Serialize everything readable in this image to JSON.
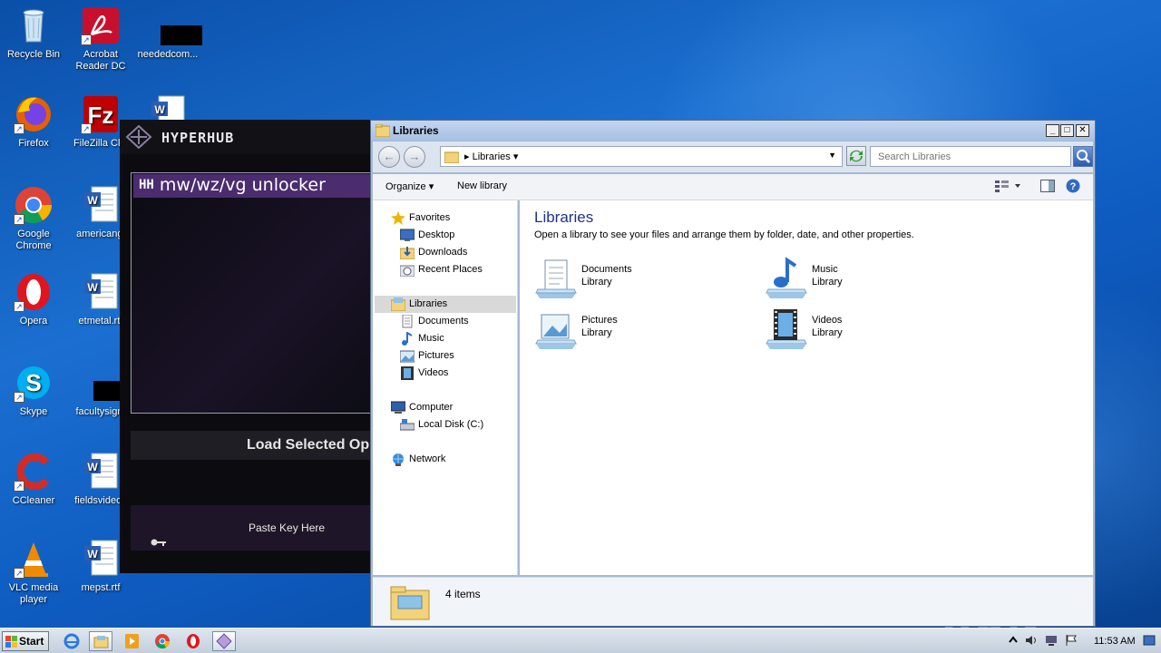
{
  "desktop": {
    "icons": [
      {
        "label": "Recycle Bin",
        "icon": "recycle-bin-icon"
      },
      {
        "label": "Acrobat\nReader DC",
        "icon": "acrobat-icon"
      },
      {
        "label": "neededcom...",
        "icon": "redacted-file-icon"
      },
      {
        "label": "Firefox",
        "icon": "firefox-icon"
      },
      {
        "label": "FileZilla Clie",
        "icon": "filezilla-icon"
      },
      {
        "label": "Google\nChrome",
        "icon": "chrome-icon"
      },
      {
        "label": "americangi",
        "icon": "word-doc-icon"
      },
      {
        "label": "Opera",
        "icon": "opera-icon"
      },
      {
        "label": "etmetal.rtf",
        "icon": "word-doc-icon"
      },
      {
        "label": "Skype",
        "icon": "skype-icon"
      },
      {
        "label": "facultysign.",
        "icon": "redacted-file-icon"
      },
      {
        "label": "CCleaner",
        "icon": "ccleaner-icon"
      },
      {
        "label": "fieldsvideos",
        "icon": "word-doc-icon"
      },
      {
        "label": "VLC media\nplayer",
        "icon": "vlc-icon"
      },
      {
        "label": "mepst.rtf",
        "icon": "word-doc-icon"
      }
    ]
  },
  "hyperhub": {
    "logo_text": "HYPERHUB",
    "selected_mark": "HH",
    "selected_item": "mw/wz/vg unlocker",
    "load_button": "Load Selected Op",
    "key_label": "Paste Key Here"
  },
  "explorer": {
    "title": "Libraries",
    "address_crumb": "Libraries",
    "search_placeholder": "Search Libraries",
    "toolbar": {
      "organize": "Organize",
      "new_library": "New library"
    },
    "nav": {
      "favorites": "Favorites",
      "desktop": "Desktop",
      "downloads": "Downloads",
      "recent_places": "Recent Places",
      "libraries": "Libraries",
      "documents": "Documents",
      "music": "Music",
      "pictures": "Pictures",
      "videos": "Videos",
      "computer": "Computer",
      "local_disk": "Local Disk (C:)",
      "network": "Network"
    },
    "content": {
      "title": "Libraries",
      "subtitle": "Open a library to see your files and arrange them by folder, date, and other properties.",
      "libraries": [
        {
          "name": "Documents",
          "type": "Library"
        },
        {
          "name": "Music",
          "type": "Library"
        },
        {
          "name": "Pictures",
          "type": "Library"
        },
        {
          "name": "Videos",
          "type": "Library"
        }
      ]
    },
    "status": {
      "count": "4 items"
    }
  },
  "watermark": "ANY RUN",
  "taskbar": {
    "start": "Start",
    "clock": "11:53 AM"
  },
  "colors": {
    "desktop": "#0e5bc0",
    "hyperhub_accent": "#4b2c6e",
    "explorer_title": "#1e3287"
  }
}
